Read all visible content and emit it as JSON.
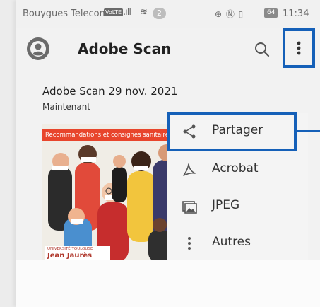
{
  "status_bar": {
    "carrier": "Bouygues Telecom",
    "volte": "VoLTE",
    "notif_count": "2",
    "battery": "64",
    "time": "11:34"
  },
  "appbar": {
    "title": "Adobe Scan",
    "avatar_icon": "account-icon",
    "search_icon": "search-icon",
    "overflow_icon": "more-vert-icon",
    "highlight_color": "#1560b8"
  },
  "document": {
    "title": "Adobe Scan 29 nov. 2021",
    "time": "Maintenant",
    "banner": "Recommandations et consignes sanitaires pour",
    "logo_small": "UNIVERSITÉ TOULOUSE",
    "logo_big": "Jean Jaurès"
  },
  "menu": {
    "items": [
      {
        "label": "Partager",
        "icon": "share-icon"
      },
      {
        "label": "Acrobat",
        "icon": "acrobat-icon"
      },
      {
        "label": "JPEG",
        "icon": "image-icon"
      },
      {
        "label": "Autres",
        "icon": "more-vert-icon"
      }
    ]
  }
}
